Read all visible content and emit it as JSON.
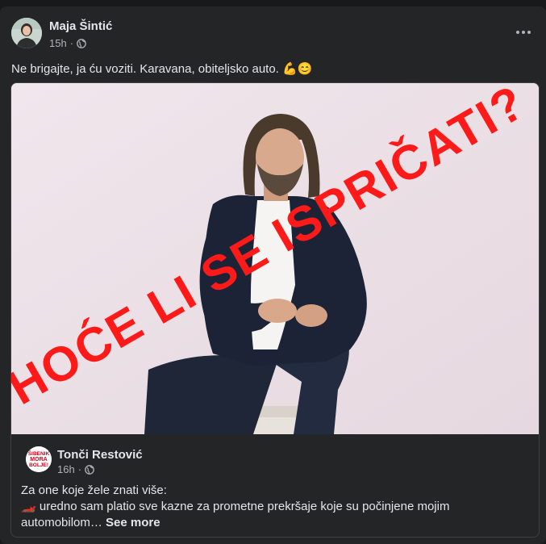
{
  "post": {
    "author": "Maja Šintić",
    "time": "15h",
    "separator": "·",
    "text": "Ne brigajte, ja ću voziti. Karavana, obiteljsko auto. 💪😊"
  },
  "image": {
    "overlay_text": "HOĆE LI SE ISPRIČATI?"
  },
  "shared": {
    "author": "Tonči Restović",
    "time": "16h",
    "separator": "·",
    "avatar_logo_text": [
      "ŠIBENIK",
      "MORA",
      "BOLJE!"
    ],
    "line1": "Za one koje žele znati više:",
    "line2_icon": "🏎️",
    "line2": " uredno sam platio sve kazne za prometne prekršaje koje su počinjene mojim",
    "line3": "automobilom… ",
    "see_more": "See more"
  },
  "icons": {
    "globe": "globe-icon",
    "more": "more-options-icon"
  }
}
